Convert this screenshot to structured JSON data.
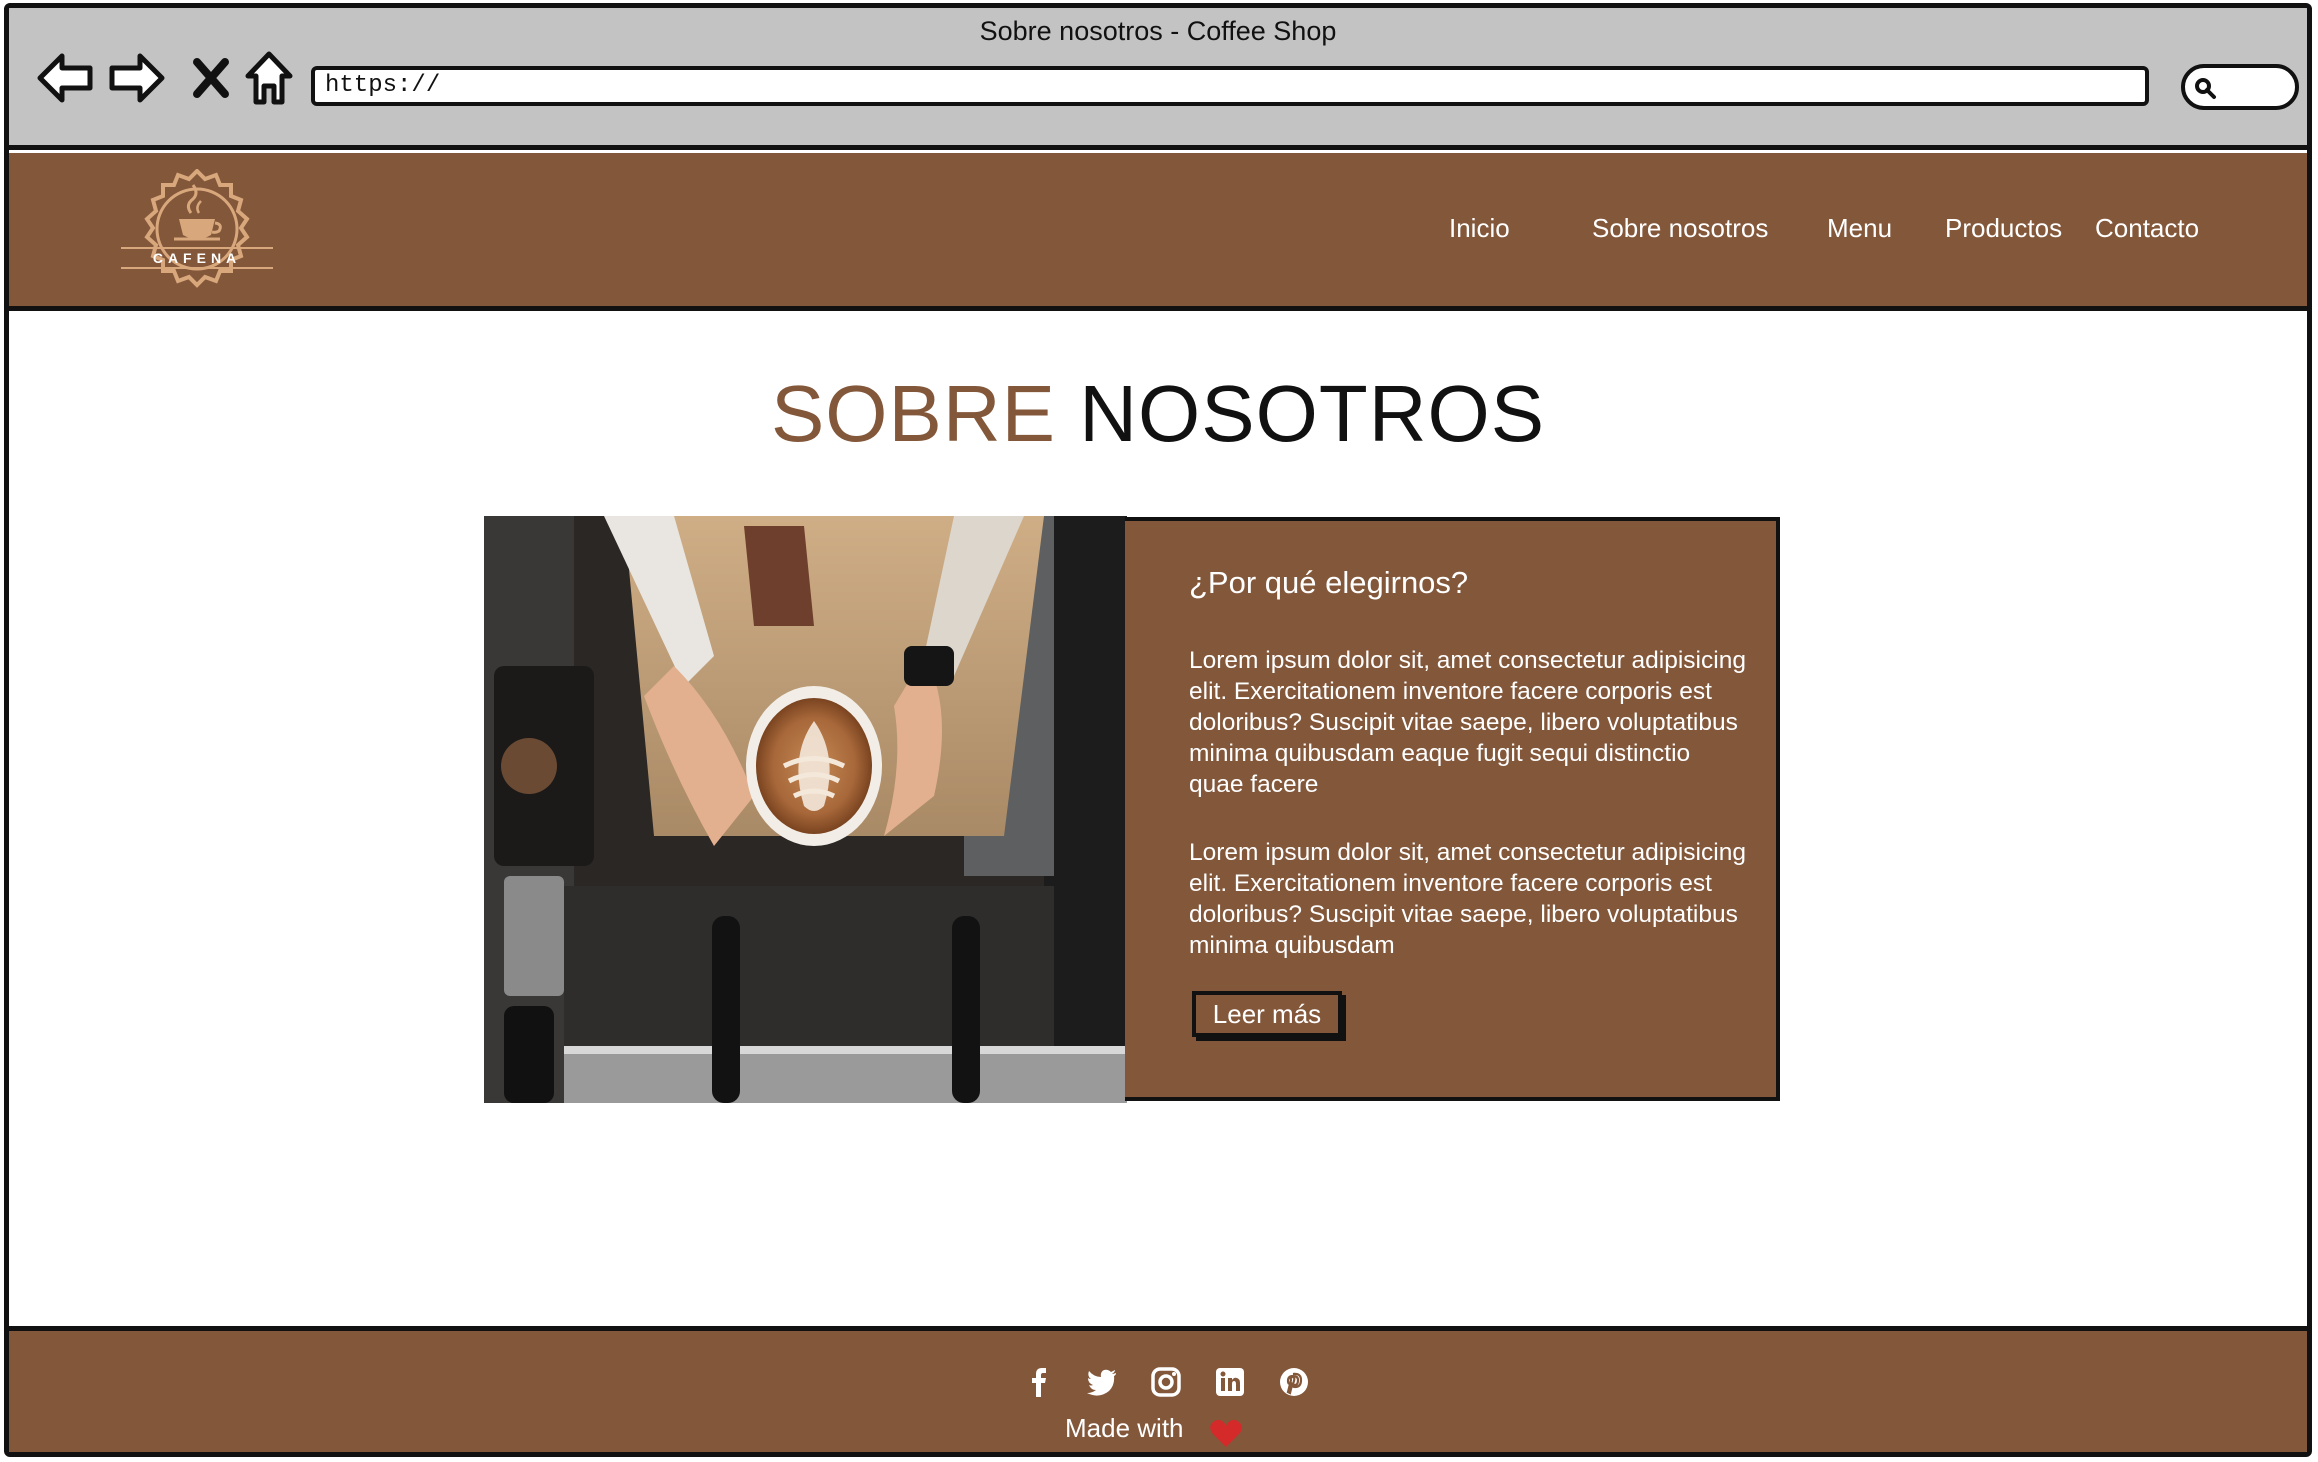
{
  "window": {
    "title": "Sobre nosotros - Coffee Shop",
    "url": "https://"
  },
  "browser_controls": {
    "back": "back-arrow-icon",
    "forward": "forward-arrow-icon",
    "stop": "close-icon",
    "home": "home-icon",
    "search": "search-icon"
  },
  "header": {
    "logo_text": "CAFENA",
    "nav": [
      {
        "label": "Inicio"
      },
      {
        "label": "Sobre nosotros"
      },
      {
        "label": "Menu"
      },
      {
        "label": "Productos"
      },
      {
        "label": "Contacto"
      }
    ]
  },
  "main": {
    "title_part1": "SOBRE",
    "title_part2": "NOSOTROS",
    "card": {
      "heading": "¿Por qué elegirnos?",
      "paragraph1": "Lorem ipsum dolor sit, amet consectetur adipisicing elit. Exercitationem inventore facere corporis est doloribus? Suscipit vitae saepe, libero voluptatibus minima quibusdam eaque fugit sequi distinctio quae facere",
      "paragraph2": "Lorem ipsum dolor sit, amet consectetur adipisicing elit. Exercitationem inventore facere corporis est doloribus? Suscipit vitae saepe, libero voluptatibus minima quibusdam",
      "button": "Leer más"
    }
  },
  "footer": {
    "social_icons": [
      "facebook-icon",
      "twitter-icon",
      "instagram-icon",
      "linkedin-icon",
      "pinterest-icon"
    ],
    "made_with": "Made with",
    "heart_color": "#d42a2a"
  },
  "colors": {
    "brand_brown": "#83573a",
    "chrome_gray": "#c3c3c3"
  }
}
